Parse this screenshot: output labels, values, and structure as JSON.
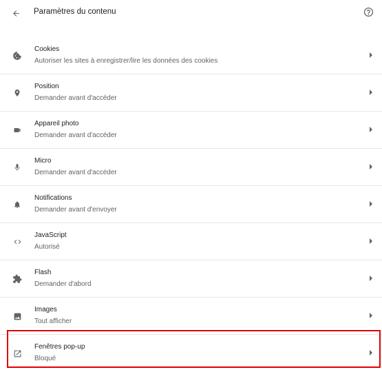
{
  "header": {
    "title": "Paramètres du contenu",
    "back_icon": "arrow-back-icon",
    "help_icon": "help-circle-icon"
  },
  "items": [
    {
      "label": "Cookies",
      "sub": "Autoriser les sites à enregistrer/lire les données des cookies",
      "icon": "cookie-icon"
    },
    {
      "label": "Position",
      "sub": "Demander avant d'accéder",
      "icon": "location-pin-icon"
    },
    {
      "label": "Appareil photo",
      "sub": "Demander avant d'accéder",
      "icon": "camera-icon"
    },
    {
      "label": "Micro",
      "sub": "Demander avant d'accéder",
      "icon": "microphone-icon"
    },
    {
      "label": "Notifications",
      "sub": "Demander avant d'envoyer",
      "icon": "bell-icon"
    },
    {
      "label": "JavaScript",
      "sub": "Autorisé",
      "icon": "code-icon"
    },
    {
      "label": "Flash",
      "sub": "Demander d'abord",
      "icon": "puzzle-icon"
    },
    {
      "label": "Images",
      "sub": "Tout afficher",
      "icon": "image-icon"
    },
    {
      "label": "Fenêtres pop-up",
      "sub": "Bloqué",
      "icon": "open-in-new-icon"
    }
  ],
  "colors": {
    "highlight": "#e00000",
    "icon": "#5f6368",
    "divider": "#e6e6e6"
  }
}
